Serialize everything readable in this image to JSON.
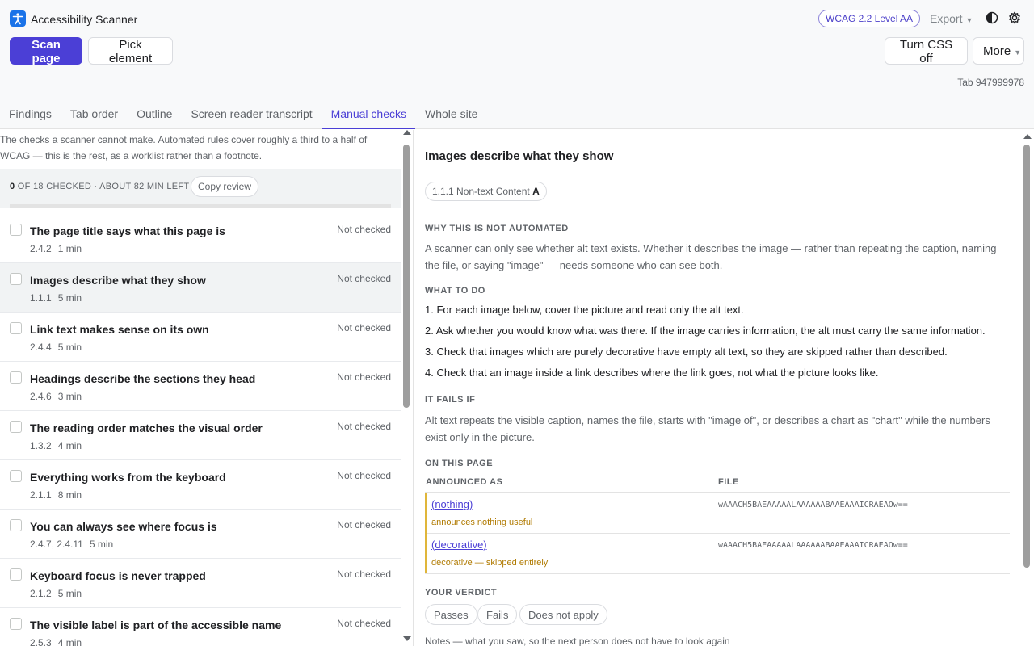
{
  "app": {
    "title": "Accessibility Scanner"
  },
  "header": {
    "wcag_badge": "WCAG 2.2 Level AA",
    "export_label": "Export",
    "scan_label": "Scan page",
    "pick_label": "Pick element",
    "css_label": "Turn CSS off",
    "more_label": "More",
    "tab_id": "Tab 947999978"
  },
  "tabs": [
    {
      "label": "Findings",
      "active": false
    },
    {
      "label": "Tab order",
      "active": false
    },
    {
      "label": "Outline",
      "active": false
    },
    {
      "label": "Screen reader transcript",
      "active": false
    },
    {
      "label": "Manual checks",
      "active": true
    },
    {
      "label": "Whole site",
      "active": false
    }
  ],
  "left": {
    "intro": "The checks a scanner cannot make. Automated rules cover roughly a third to a half of WCAG — this is the rest, as a worklist rather than a footnote.",
    "progress_count": "0",
    "progress_text": "OF 18 CHECKED · ABOUT 82 MIN LEFT",
    "copy_review": "Copy review",
    "checks": [
      {
        "title": "The page title says what this page is",
        "criterion": "2.4.2",
        "time": "1 min",
        "status": "Not checked",
        "selected": false
      },
      {
        "title": "Images describe what they show",
        "criterion": "1.1.1",
        "time": "5 min",
        "status": "Not checked",
        "selected": true
      },
      {
        "title": "Link text makes sense on its own",
        "criterion": "2.4.4",
        "time": "5 min",
        "status": "Not checked",
        "selected": false
      },
      {
        "title": "Headings describe the sections they head",
        "criterion": "2.4.6",
        "time": "3 min",
        "status": "Not checked",
        "selected": false
      },
      {
        "title": "The reading order matches the visual order",
        "criterion": "1.3.2",
        "time": "4 min",
        "status": "Not checked",
        "selected": false
      },
      {
        "title": "Everything works from the keyboard",
        "criterion": "2.1.1",
        "time": "8 min",
        "status": "Not checked",
        "selected": false
      },
      {
        "title": "You can always see where focus is",
        "criterion": "2.4.7, 2.4.11",
        "time": "5 min",
        "status": "Not checked",
        "selected": false
      },
      {
        "title": "Keyboard focus is never trapped",
        "criterion": "2.1.2",
        "time": "5 min",
        "status": "Not checked",
        "selected": false
      },
      {
        "title": "The visible label is part of the accessible name",
        "criterion": "2.5.3",
        "time": "4 min",
        "status": "Not checked",
        "selected": false
      }
    ]
  },
  "detail": {
    "title": "Images describe what they show",
    "criterion_text": "1.1.1 Non-text Content",
    "criterion_level": "A",
    "why_heading": "WHY THIS IS NOT AUTOMATED",
    "why_text": "A scanner can only see whether alt text exists. Whether it describes the image — rather than repeating the caption, naming the file, or saying \"image\" — needs someone who can see both.",
    "todo_heading": "WHAT TO DO",
    "steps": [
      "1. For each image below, cover the picture and read only the alt text.",
      "2. Ask whether you would know what was there. If the image carries information, the alt must carry the same information.",
      "3. Check that images which are purely decorative have empty alt text, so they are skipped rather than described.",
      "4. Check that an image inside a link describes where the link goes, not what the picture looks like."
    ],
    "fails_heading": "IT FAILS IF",
    "fails_text": "Alt text repeats the visible caption, names the file, starts with \"image of\", or describes a chart as \"chart\" while the numbers exist only in the picture.",
    "page_heading": "ON THIS PAGE",
    "col_announced": "ANNOUNCED AS",
    "col_file": "FILE",
    "images": [
      {
        "announced": "(nothing)",
        "note": "announces nothing useful",
        "file": "wAAACH5BAEAAAAALAAAAAABAAEAAAICRAEAOw=="
      },
      {
        "announced": "(decorative)",
        "note": "decorative — skipped entirely",
        "file": "wAAACH5BAEAAAAALAAAAAABAAEAAAICRAEAOw=="
      }
    ],
    "verdict_heading": "YOUR VERDICT",
    "verdict_pass": "Passes",
    "verdict_fail": "Fails",
    "verdict_na": "Does not apply",
    "notes_label": "Notes — what you saw, so the next person does not have to look again"
  },
  "colors": {
    "accent": "#4b3fd6",
    "warning": "#e0b63a"
  }
}
